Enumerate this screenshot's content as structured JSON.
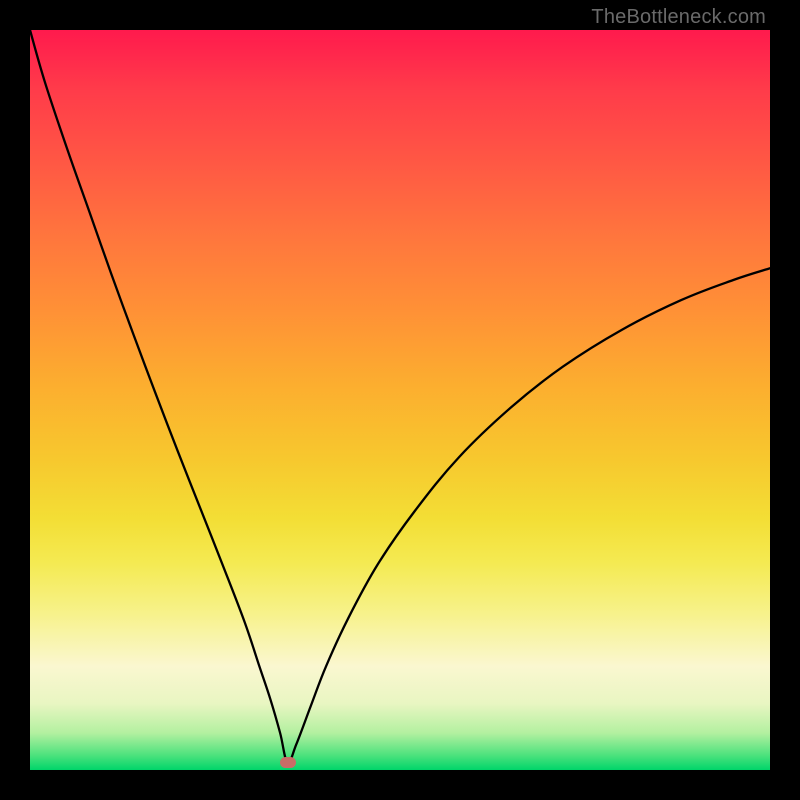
{
  "watermark": "TheBottleneck.com",
  "colors": {
    "frame": "#000000",
    "gradient_top": "#ff1a4d",
    "gradient_mid": "#f7c82e",
    "gradient_bottom": "#00d56a",
    "curve": "#000000",
    "marker": "#c96d67"
  },
  "chart_data": {
    "type": "line",
    "title": "",
    "xlabel": "",
    "ylabel": "",
    "xlim": [
      0,
      100
    ],
    "ylim": [
      0,
      100
    ],
    "annotations": [
      {
        "name": "marker",
        "x": 34.8,
        "y": 1.0
      }
    ],
    "series": [
      {
        "name": "bottleneck-curve",
        "x": [
          0,
          2,
          5,
          8,
          11,
          14,
          17,
          20,
          23,
          26,
          29,
          31,
          32.5,
          33.8,
          34.8,
          36,
          38,
          40,
          43,
          47,
          52,
          58,
          65,
          72,
          80,
          88,
          95,
          100
        ],
        "values": [
          100,
          93,
          84,
          75.5,
          67,
          58.8,
          50.8,
          43,
          35.4,
          27.8,
          20,
          14,
          9.5,
          5,
          1.0,
          3.5,
          8.8,
          14,
          20.5,
          27.8,
          35,
          42.3,
          49,
          54.5,
          59.5,
          63.5,
          66.2,
          67.8
        ]
      }
    ]
  }
}
